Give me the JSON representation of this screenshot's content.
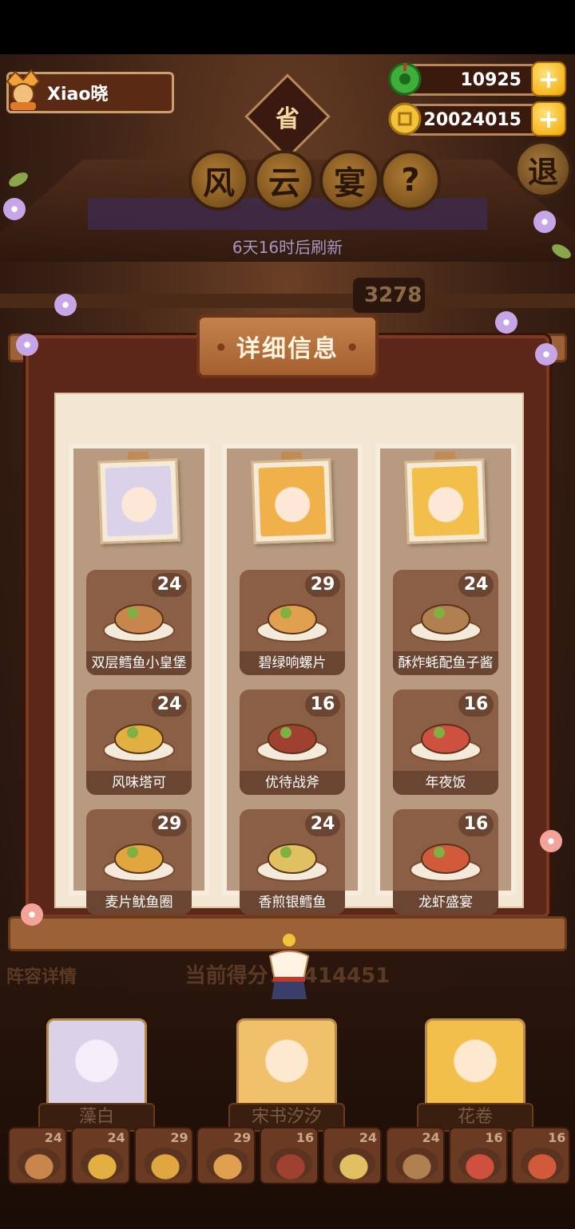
{
  "player": {
    "name": "Xiao晓"
  },
  "currency": {
    "jade": "10925",
    "coins": "20024015",
    "plus": "+"
  },
  "header": {
    "province": "省",
    "title_chars": [
      "风",
      "云",
      "宴"
    ],
    "help": "?",
    "exit": "退",
    "refresh": "6天16时后刷新",
    "score_partial": "3278"
  },
  "modal": {
    "title": "详细信息",
    "columns": [
      {
        "portrait_color": "#d9d2e8",
        "dishes": [
          {
            "level": "24",
            "name": "双层鳕鱼小皇堡",
            "color": "#c8864c"
          },
          {
            "level": "24",
            "name": "风味塔可",
            "color": "#e2b040"
          },
          {
            "level": "29",
            "name": "麦片鱿鱼圈",
            "color": "#e2a640"
          }
        ]
      },
      {
        "portrait_color": "#f0b04a",
        "dishes": [
          {
            "level": "29",
            "name": "碧绿响螺片",
            "color": "#e0a050"
          },
          {
            "level": "16",
            "name": "优待战斧",
            "color": "#a04030"
          },
          {
            "level": "24",
            "name": "香煎银鳕鱼",
            "color": "#e0c060"
          }
        ]
      },
      {
        "portrait_color": "#f2c04a",
        "dishes": [
          {
            "level": "24",
            "name": "酥炸蚝配鱼子酱",
            "color": "#b08050"
          },
          {
            "level": "16",
            "name": "年夜饭",
            "color": "#d05040"
          },
          {
            "level": "16",
            "name": "龙虾盛宴",
            "color": "#d05a3a"
          }
        ]
      }
    ]
  },
  "bottom": {
    "team_label": "阵容详情",
    "score_text": "当前得分：1414451",
    "members": [
      {
        "name": "藻白",
        "color": "#d9d2e8"
      },
      {
        "name": "宋书汐汐",
        "color": "#f0c06a"
      },
      {
        "name": "花卷",
        "color": "#f2c04a"
      }
    ],
    "mini_dishes": [
      "24",
      "24",
      "29",
      "29",
      "16",
      "24",
      "24",
      "16",
      "16"
    ]
  }
}
